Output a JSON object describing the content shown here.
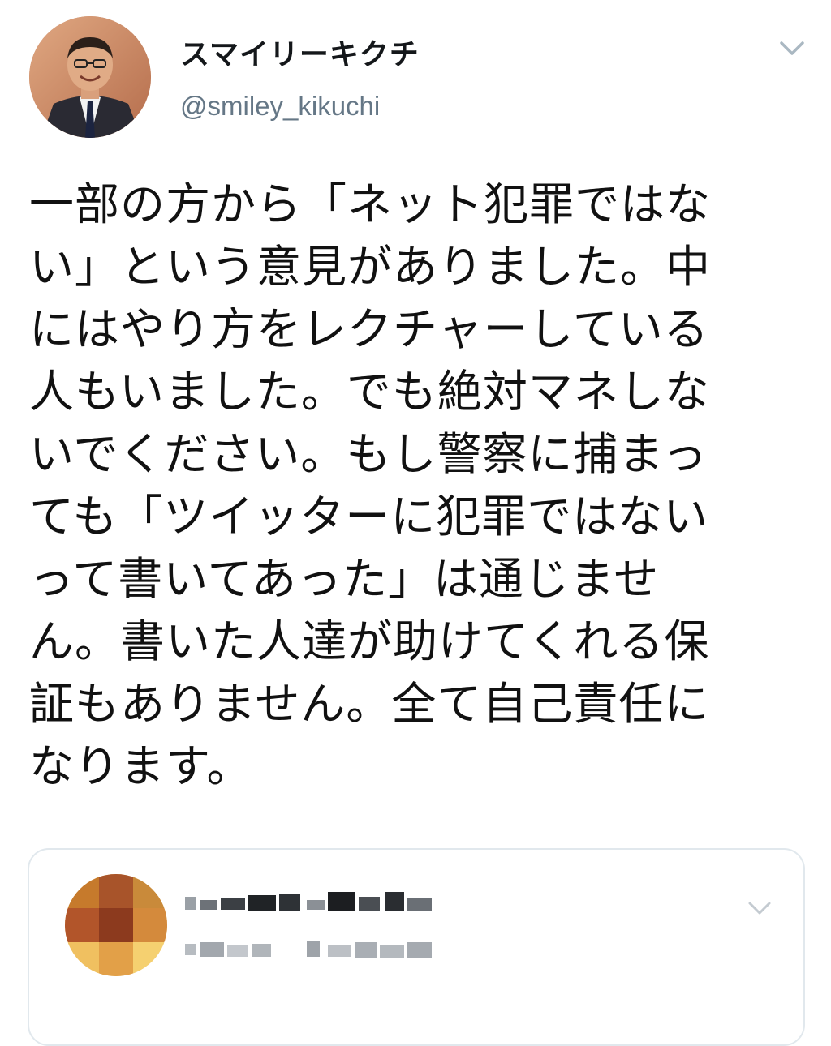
{
  "tweet": {
    "author": {
      "display_name": "スマイリーキクチ",
      "handle": "@smiley_kikuchi",
      "avatar_icon": "profile-photo-icon"
    },
    "menu_icon": "chevron-down-icon",
    "text_lines": [
      "一部の方から「ネット犯罪ではな",
      "い」という意見がありました。中",
      "にはやり方をレクチャーしている",
      "人もいました。でも絶対マネしな",
      "いでください。もし警察に捕まっ",
      "ても「ツイッターに犯罪ではない",
      "って書いてあった」は通じませ",
      "ん。書いた人達が助けてくれる保",
      "証もありません。全て自己責任に",
      "なります。"
    ]
  },
  "quoted_tweet": {
    "avatar_icon": "blurred-avatar-icon",
    "menu_icon": "chevron-down-icon"
  },
  "colors": {
    "text": "#111111",
    "handle": "#657786",
    "border": "#e1e8ed",
    "caret": "#aab8c2"
  }
}
